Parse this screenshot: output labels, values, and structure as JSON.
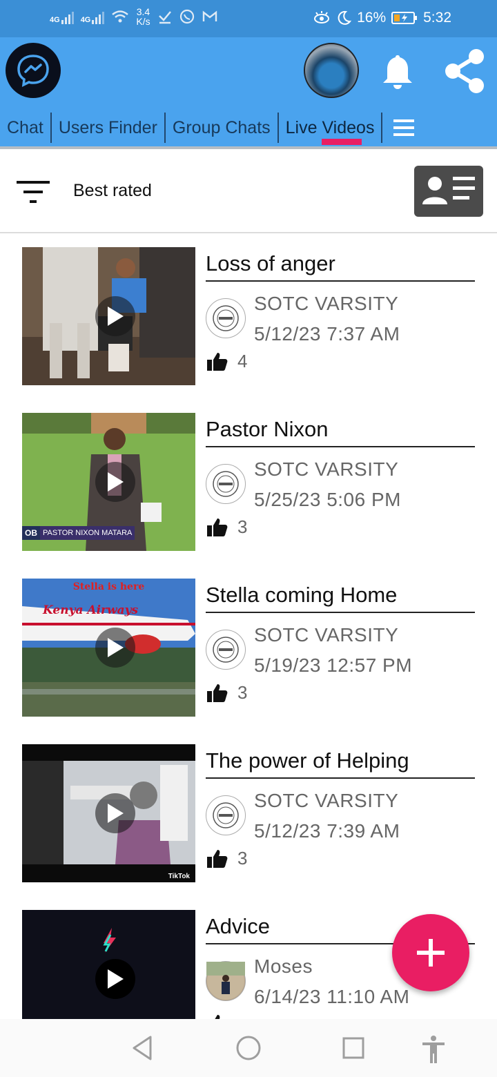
{
  "status_bar": {
    "network1": "4G",
    "network2": "4G",
    "speed_value": "3.4",
    "speed_unit": "K/s",
    "battery": "16%",
    "time": "5:32"
  },
  "tabs": [
    {
      "label": "Chat"
    },
    {
      "label": "Users Finder"
    },
    {
      "label": "Group Chats"
    },
    {
      "label": "Live Videos"
    }
  ],
  "active_tab": "Live Videos",
  "filter": {
    "label": "Best rated"
  },
  "videos": [
    {
      "title": "Loss of anger",
      "author": "SOTC VARSITY",
      "date": "5/12/23 7:37 AM",
      "likes": "4"
    },
    {
      "title": "Pastor Nixon",
      "author": "SOTC VARSITY",
      "date": "5/25/23 5:06 PM",
      "likes": "3",
      "caption_left": "OB",
      "caption_right": "PASTOR NIXON MATARA"
    },
    {
      "title": "Stella coming Home",
      "author": "SOTC VARSITY",
      "date": "5/19/23 12:57 PM",
      "likes": "3",
      "overlay": "Stella is here",
      "airline": "Kenya Airways"
    },
    {
      "title": "The power of Helping",
      "author": "SOTC VARSITY",
      "date": "5/12/23 7:39 AM",
      "likes": "3",
      "watermark": "TikTok"
    },
    {
      "title": "Advice",
      "author": "Moses",
      "date": "6/14/23 11:10 AM",
      "likes": ""
    }
  ],
  "colors": {
    "appbar": "#4aa3ee",
    "statusbar": "#3b8fd6",
    "accent": "#e91e63",
    "tab_text": "#17395a"
  },
  "icons": [
    "messenger-icon",
    "bell-icon",
    "share-icon",
    "menu-icon",
    "filter-icon",
    "contact-card-icon",
    "play-icon",
    "thumbs-up-icon",
    "add-icon",
    "back-icon",
    "home-icon",
    "recents-icon",
    "accessibility-icon"
  ]
}
